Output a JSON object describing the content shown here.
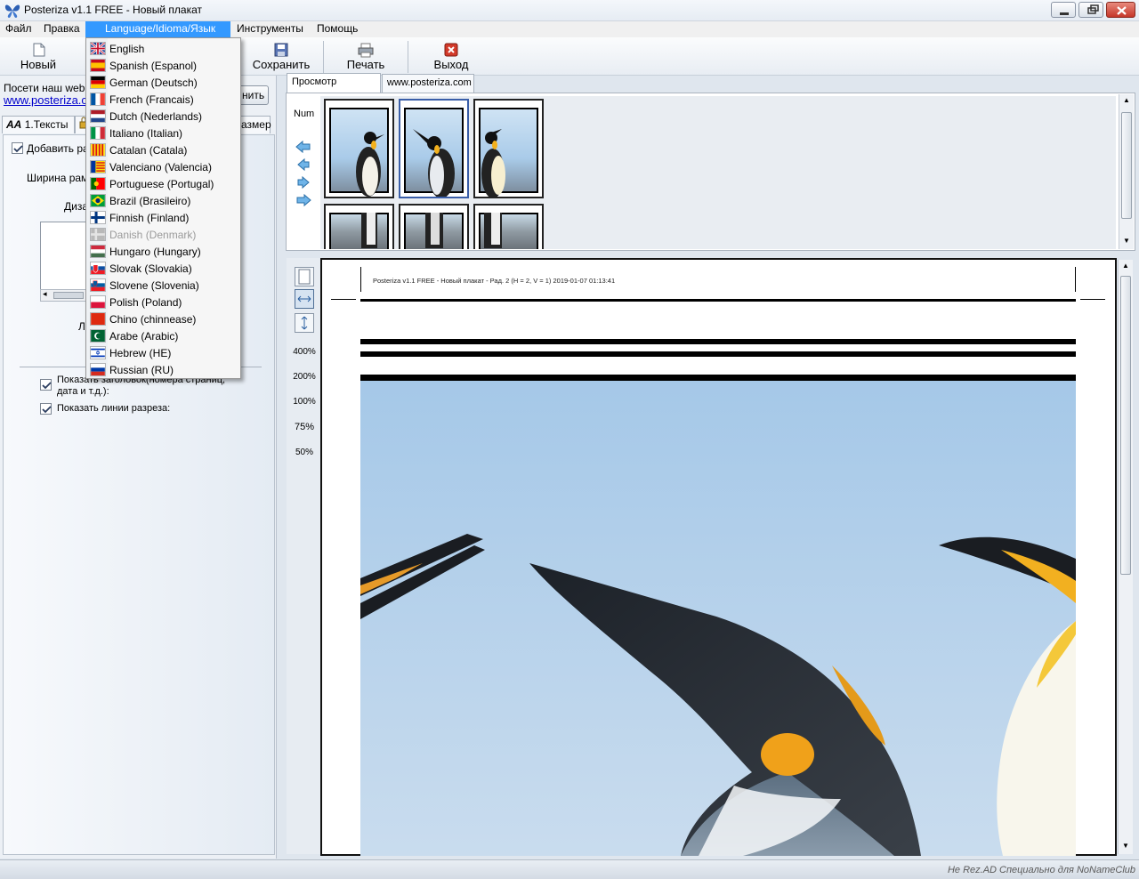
{
  "window": {
    "title": "Posteriza v1.1 FREE - Новый плакат"
  },
  "menu": {
    "file": "Файл",
    "edit": "Правка",
    "language": "Language/Idioma/Язык",
    "tools": "Инструменты",
    "help": "Помощь"
  },
  "toolbar": {
    "new": "Новый",
    "save": "Сохранить",
    "print": "Печать",
    "exit": "Выход"
  },
  "left_panel": {
    "visit_text": "Посети наш web-са",
    "link": "www.posteriza.c",
    "button_partial": "нить",
    "tabs": [
      "1.Тексты",
      "азмер"
    ],
    "add_frame": "Добавить рам",
    "frame_width": "Ширина рамк",
    "design": "Диза",
    "li_label": "Л",
    "show_header": "Показать заголовок(номера страниц,",
    "show_header_2": "дата и т.д.):",
    "show_cut_lines": "Показать линии разреза:"
  },
  "right_panel": {
    "tabs": [
      "Просмотр Плаката",
      "www.posteriza.com"
    ],
    "num_label": "Num",
    "zoom_levels": [
      "400%",
      "200%",
      "100%",
      "75%",
      "50%"
    ],
    "page_header": "Posteriza v1.1 FREE - Новый плакат - Рад. 2 (Н = 2, V = 1) 2019-01-07  01:13:41"
  },
  "language_menu": {
    "items": [
      {
        "label": "English",
        "flag": "gb"
      },
      {
        "label": "Spanish (Espanol)",
        "flag": "es"
      },
      {
        "label": "German (Deutsch)",
        "flag": "de"
      },
      {
        "label": "French (Francais)",
        "flag": "fr"
      },
      {
        "label": "Dutch (Nederlands)",
        "flag": "nl"
      },
      {
        "label": "Italiano (Italian)",
        "flag": "it"
      },
      {
        "label": "Catalan (Catala)",
        "flag": "cat"
      },
      {
        "label": "Valenciano (Valencia)",
        "flag": "val"
      },
      {
        "label": "Portuguese (Portugal)",
        "flag": "pt"
      },
      {
        "label": "Brazil (Brasileiro)",
        "flag": "br"
      },
      {
        "label": "Finnish (Finland)",
        "flag": "fi"
      },
      {
        "label": "Danish (Denmark)",
        "flag": "dk",
        "disabled": true
      },
      {
        "label": "Hungaro (Hungary)",
        "flag": "hu"
      },
      {
        "label": "Slovak (Slovakia)",
        "flag": "sk"
      },
      {
        "label": "Slovene (Slovenia)",
        "flag": "si"
      },
      {
        "label": "Polish (Poland)",
        "flag": "pl"
      },
      {
        "label": "Chino (chinnease)",
        "flag": "cn"
      },
      {
        "label": "Arabe (Arabic)",
        "flag": "ar"
      },
      {
        "label": "Hebrew (HE)",
        "flag": "il"
      },
      {
        "label": "Russian (RU)",
        "flag": "ru"
      }
    ]
  },
  "status": {
    "watermark": "Не Rez.AD Специально для NoNameClub"
  },
  "colors": {
    "menu_highlight": "#3399ff",
    "link": "#0000cc",
    "sky": "#a9cbe9"
  }
}
